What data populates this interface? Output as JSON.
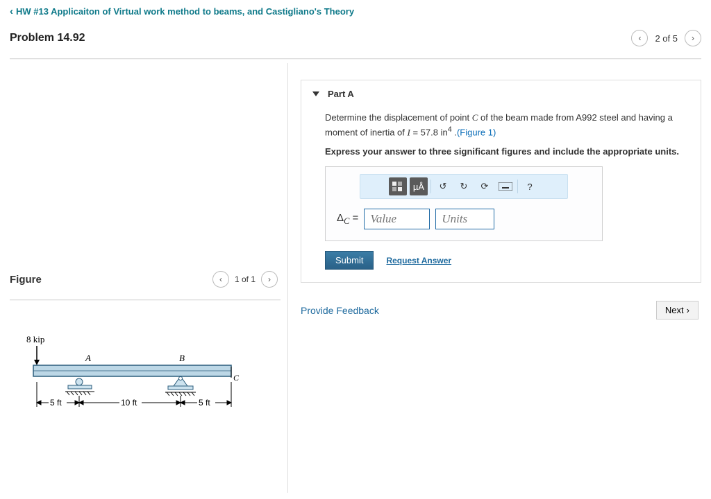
{
  "nav": {
    "back_label": "HW #13 Applicaiton of Virtual work method to beams, and Castigliano's Theory"
  },
  "problem": {
    "title": "Problem 14.92",
    "pager": "2 of 5"
  },
  "figure": {
    "title": "Figure",
    "pager": "1 of 1",
    "load_label": "8 kip",
    "seg_A": "A",
    "seg_B": "B",
    "pt_C": "C",
    "dim1": "5 ft",
    "dim2": "10 ft",
    "dim3": "5 ft"
  },
  "partA": {
    "heading": "Part A",
    "text1_pre": "Determine the displacement of point ",
    "text1_C": "C",
    "text1_mid": " of the beam made from A992 steel and having a moment of inertia of ",
    "text1_I": "I",
    "text1_eq": " = 57.8  in",
    "text1_exp": "4",
    "text1_post": " .",
    "fig_link": "(Figure 1)",
    "instruction": "Express your answer to three significant figures and include the appropriate units.",
    "toolbar": {
      "units_hint": "µÅ",
      "help": "?"
    },
    "eq_label_pre": "Δ",
    "eq_label_sub": "C",
    "eq_label_post": " =",
    "value_placeholder": "Value",
    "units_placeholder": "Units",
    "submit": "Submit",
    "request": "Request Answer"
  },
  "footer": {
    "feedback": "Provide Feedback",
    "next": "Next"
  }
}
